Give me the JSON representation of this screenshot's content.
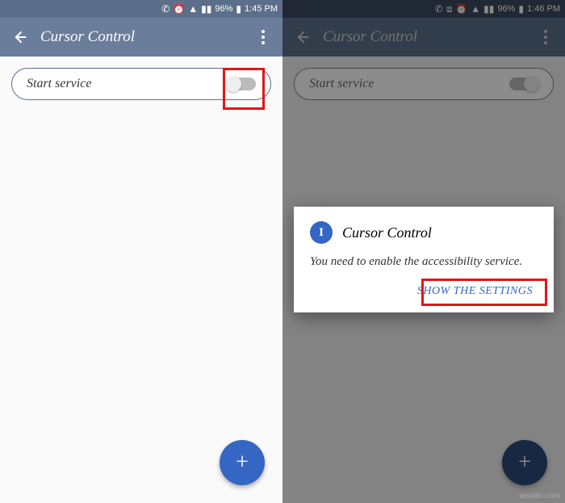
{
  "left": {
    "status": {
      "battery": "96%",
      "time": "1:45 PM"
    },
    "app_bar": {
      "title": "Cursor Control"
    },
    "card": {
      "label": "Start service"
    },
    "fab": {
      "glyph": "+"
    }
  },
  "right": {
    "status": {
      "battery": "96%",
      "time": "1:46 PM"
    },
    "app_bar": {
      "title": "Cursor Control"
    },
    "card": {
      "label": "Start service"
    },
    "fab": {
      "glyph": "+"
    },
    "dialog": {
      "icon_letter": "I",
      "title": "Cursor Control",
      "message": "You need to enable the accessibility service.",
      "action": "SHOW THE SETTINGS"
    }
  },
  "watermark": "wsxdn.com"
}
